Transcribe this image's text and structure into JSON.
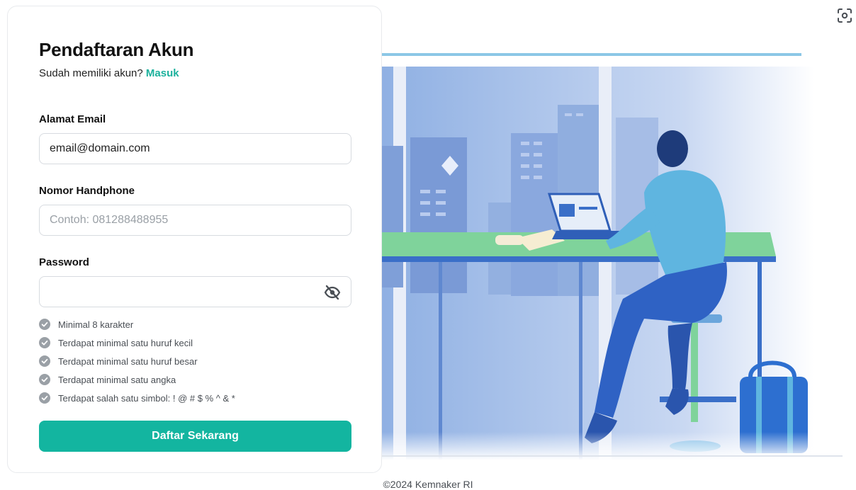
{
  "form": {
    "title": "Pendaftaran Akun",
    "login_prompt": "Sudah memiliki akun?",
    "login_link": "Masuk",
    "email_label": "Alamat Email",
    "email_value": "email@domain.com",
    "phone_label": "Nomor Handphone",
    "phone_placeholder": "Contoh: 081288488955",
    "password_label": "Password",
    "password_value": "",
    "submit_label": "Daftar Sekarang"
  },
  "password_rules": [
    "Minimal 8 karakter",
    "Terdapat minimal satu huruf kecil",
    "Terdapat minimal satu huruf besar",
    "Terdapat minimal satu angka",
    "Terdapat salah satu simbol: ! @ # $ % ^ & *"
  ],
  "footer": {
    "copyright": "©2024 Kemnaker RI"
  },
  "icons": {
    "password_toggle": "eye-off-icon",
    "rule_status": "check-circle-icon",
    "top_right": "scan-icon"
  },
  "colors": {
    "accent": "#13b5a0",
    "link": "#1bb19c",
    "rule_check": "#9aa0a6"
  }
}
